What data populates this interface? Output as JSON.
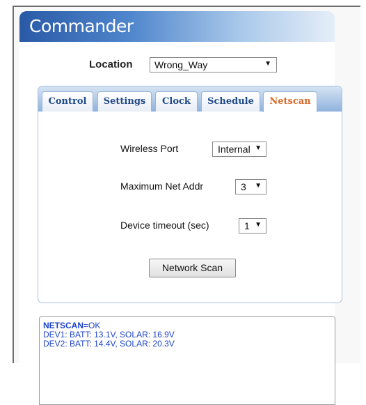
{
  "app": {
    "title": "Commander"
  },
  "location": {
    "label": "Location",
    "selected": "Wrong_Way"
  },
  "tabs": [
    {
      "label": "Control",
      "active": false
    },
    {
      "label": "Settings",
      "active": false
    },
    {
      "label": "Clock",
      "active": false
    },
    {
      "label": "Schedule",
      "active": false
    },
    {
      "label": "Netscan",
      "active": true
    }
  ],
  "netscan": {
    "wireless_port": {
      "label": "Wireless Port",
      "value": "Internal"
    },
    "max_net_addr": {
      "label": "Maximum Net Addr",
      "value": "3"
    },
    "device_timeout": {
      "label": "Device timeout (sec)",
      "value": "1"
    },
    "scan_button": "Network Scan"
  },
  "log": {
    "status_key": "NETSCAN",
    "status_value": "=OK",
    "lines": [
      "DEV1: BATT: 13.1V, SOLAR: 16.9V",
      "DEV2: BATT: 14.4V, SOLAR: 20.3V"
    ]
  },
  "colors": {
    "header_start": "#2a5aa6",
    "active_tab": "#d8692a",
    "tab_text": "#1f4a86",
    "log_text": "#1e43c8"
  }
}
